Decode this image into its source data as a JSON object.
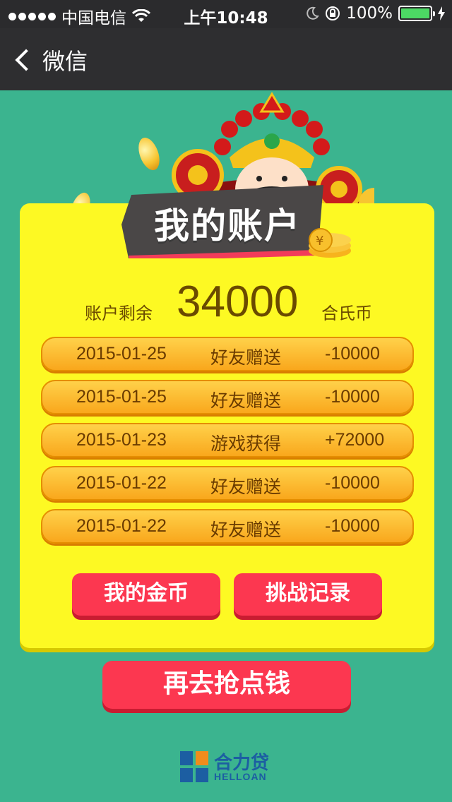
{
  "status_bar": {
    "carrier": "中国电信",
    "time": "上午10:48",
    "battery": "100%",
    "battery_level": 1.0
  },
  "nav": {
    "back_label": "微信"
  },
  "header": {
    "title": "我的账户"
  },
  "balance": {
    "label": "账户剩余",
    "value": "34000",
    "unit": "合氏币"
  },
  "records": [
    {
      "date": "2015-01-25",
      "type": "好友赠送",
      "amount": "-10000"
    },
    {
      "date": "2015-01-25",
      "type": "好友赠送",
      "amount": "-10000"
    },
    {
      "date": "2015-01-23",
      "type": "游戏获得",
      "amount": "+72000"
    },
    {
      "date": "2015-01-22",
      "type": "好友赠送",
      "amount": "-10000"
    },
    {
      "date": "2015-01-22",
      "type": "好友赠送",
      "amount": "-10000"
    }
  ],
  "buttons": {
    "my_coins": "我的金币",
    "challenge_records": "挑战记录",
    "go_again": "再去抢点钱"
  },
  "logo": {
    "cn": "合力贷",
    "en": "HELLOAN"
  },
  "colors": {
    "background": "#3bb48f",
    "card": "#fdf923",
    "button": "#fc3750",
    "record_row": "#f9a71c"
  }
}
